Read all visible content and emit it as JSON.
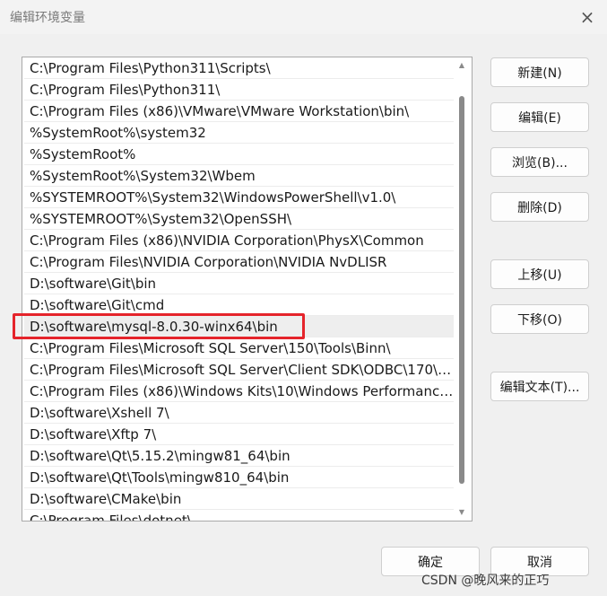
{
  "window": {
    "title": "编辑环境变量",
    "close_icon": "×"
  },
  "path_list": {
    "items": [
      "C:\\Program Files\\Python311\\Scripts\\",
      "C:\\Program Files\\Python311\\",
      "C:\\Program Files (x86)\\VMware\\VMware Workstation\\bin\\",
      "%SystemRoot%\\system32",
      "%SystemRoot%",
      "%SystemRoot%\\System32\\Wbem",
      "%SYSTEMROOT%\\System32\\WindowsPowerShell\\v1.0\\",
      "%SYSTEMROOT%\\System32\\OpenSSH\\",
      "C:\\Program Files (x86)\\NVIDIA Corporation\\PhysX\\Common",
      "C:\\Program Files\\NVIDIA Corporation\\NVIDIA NvDLISR",
      "D:\\software\\Git\\bin",
      "D:\\software\\Git\\cmd",
      "D:\\software\\mysql-8.0.30-winx64\\bin",
      "C:\\Program Files\\Microsoft SQL Server\\150\\Tools\\Binn\\",
      "C:\\Program Files\\Microsoft SQL Server\\Client SDK\\ODBC\\170\\T...",
      "C:\\Program Files (x86)\\Windows Kits\\10\\Windows Performance...",
      "D:\\software\\Xshell 7\\",
      "D:\\software\\Xftp 7\\",
      "D:\\software\\Qt\\5.15.2\\mingw81_64\\bin",
      "D:\\software\\Qt\\Tools\\mingw810_64\\bin",
      "D:\\software\\CMake\\bin",
      "C:\\Program Files\\dotnet\\"
    ],
    "selected_index": 12,
    "scroll_up_icon": "▲",
    "scroll_down_icon": "▼"
  },
  "buttons": {
    "new": "新建(N)",
    "edit": "编辑(E)",
    "browse": "浏览(B)...",
    "delete": "删除(D)",
    "move_up": "上移(U)",
    "move_down": "下移(O)",
    "edit_text": "编辑文本(T)...",
    "ok": "确定",
    "cancel": "取消"
  },
  "watermark": "CSDN @晚风来的正巧",
  "colors": {
    "highlight_border": "#e5242b",
    "selected_row": "#eeeeee"
  }
}
